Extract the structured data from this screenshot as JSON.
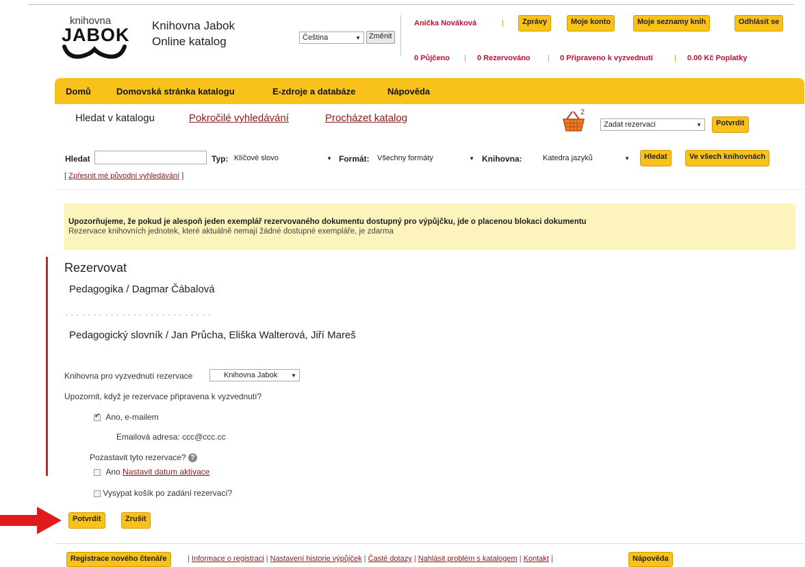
{
  "header": {
    "logo_top": "knihovna",
    "logo_main": "JABOK",
    "title_line1": "Knihovna Jabok",
    "title_line2": "Online katalog",
    "language_value": "Čeština",
    "language_change": "Změnit",
    "user_name": "Anička Nováková",
    "buttons": {
      "messages": "Zprávy",
      "account": "Moje konto",
      "lists": "Moje seznamy knih",
      "logout": "Odhlásit se"
    },
    "stats": {
      "borrowed": "0 Půjčeno",
      "reserved": "0 Rezervováno",
      "ready": "0 Připraveno k vyzvednutí",
      "fines": "0.00 Kč Poplatky"
    }
  },
  "nav": {
    "home": "Domů",
    "catalog_home": "Domovská stránka katalogu",
    "eresources": "E-zdroje a databáze",
    "help": "Nápověda"
  },
  "tabs": {
    "search": "Hledat v katalogu",
    "advanced": "Pokročilé vyhledávání",
    "browse": "Procházet katalog"
  },
  "cart": {
    "count": "2",
    "action_value": "Zadat rezervaci",
    "confirm": "Potvrdit"
  },
  "search": {
    "label": "Hledat",
    "value": "",
    "type_label": "Typ:",
    "type_value": "Klíčové slovo",
    "format_label": "Formát:",
    "format_value": "Všechny formáty",
    "library_label": "Knihovna:",
    "library_value": "Katedra jazyků",
    "search_button": "Hledat",
    "all_libraries_button": "Ve všech knihovnách",
    "refine_bracket_open": "[",
    "refine_link": "Zpřesnit mé původní vyhledávání",
    "refine_bracket_close": "]"
  },
  "notice": {
    "bold": "Upozorňujeme, že pokud je alespoň jeden exemplář rezervovaného dokumentu dostupný pro výpůjčku, jde o placenou blokaci dokumentu",
    "normal": "Rezervace knihovních jednotek, které aktuálně nemají žádné dostupné exempláře, je zdarma"
  },
  "reserve": {
    "heading": "Rezervovat",
    "item1": "Pedagogika / Dagmar Čábalová",
    "divider": "- - - - - - - - - - - - - - - - - - - - - - - - - -",
    "item2": "Pedagogický slovník / Jan Průcha, Eliška Walterová, Jiří Mareš",
    "pickup_label": "Knihovna pro vyzvednutí rezervace",
    "pickup_value": "Knihovna Jabok",
    "notify_question": "Upozornit, když je rezervace připravena k vyzvednutí?",
    "notify_email": "Ano, e-mailem",
    "email_label": "Emailová adresa:",
    "email_value": "ccc@ccc.cc",
    "suspend_question": "Pozastavit tyto rezervace?",
    "suspend_yes": "Ano",
    "suspend_link": "Nastavit datum aktivace",
    "empty_cart": "Vysypat košík po zadání rezervací?",
    "confirm": "Potvrdit",
    "cancel": "Zrušit"
  },
  "footer": {
    "register": "Registrace nového čtenáře",
    "links": [
      "Informace o registraci",
      "Nastavení historie výpůjček",
      "Časté dotazy",
      "Nahlásit problém s katalogem",
      "Kontakt"
    ],
    "help": "Nápověda"
  },
  "colors": {
    "accent": "#f9c21b",
    "notice_bg": "#fdf3bd",
    "red": "#e11b1b"
  }
}
